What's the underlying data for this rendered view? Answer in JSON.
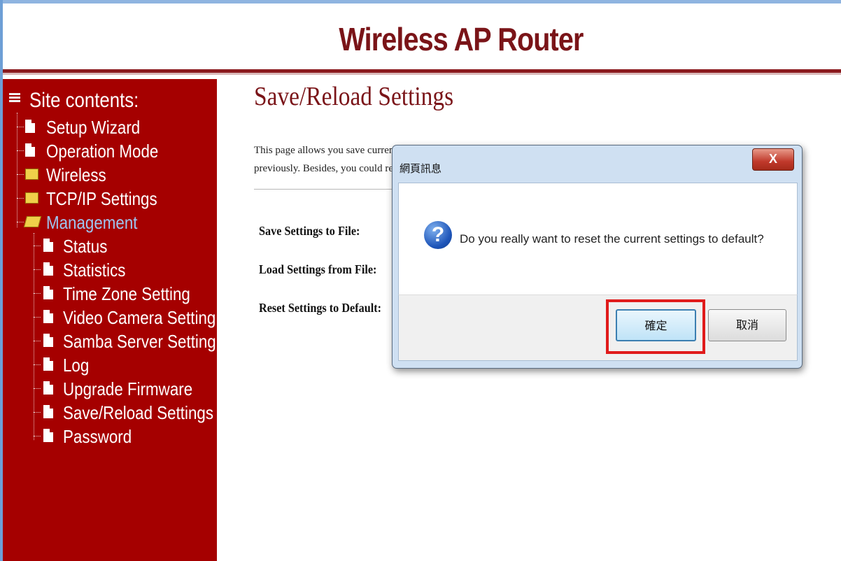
{
  "header": {
    "title": "Wireless AP Router"
  },
  "sidebar": {
    "heading": "Site contents:",
    "items": [
      {
        "label": "Setup Wizard",
        "icon": "document-icon"
      },
      {
        "label": "Operation Mode",
        "icon": "document-icon"
      },
      {
        "label": "Wireless",
        "icon": "folder-icon"
      },
      {
        "label": "TCP/IP Settings",
        "icon": "folder-icon"
      },
      {
        "label": "Management",
        "icon": "folder-open-icon",
        "active": true
      },
      {
        "label": "Status",
        "icon": "document-icon"
      },
      {
        "label": "Statistics",
        "icon": "document-icon"
      },
      {
        "label": "Time Zone Setting",
        "icon": "document-icon"
      },
      {
        "label": "Video Camera Setting",
        "icon": "document-icon"
      },
      {
        "label": "Samba Server Setting",
        "icon": "document-icon"
      },
      {
        "label": "Log",
        "icon": "document-icon"
      },
      {
        "label": "Upgrade Firmware",
        "icon": "document-icon"
      },
      {
        "label": "Save/Reload Settings",
        "icon": "document-icon"
      },
      {
        "label": "Password",
        "icon": "document-icon"
      }
    ]
  },
  "main": {
    "title": "Save/Reload Settings",
    "description_line1": "This page allows you save current settings to a file or reload the settings from the file which was saved",
    "description_line2": "previously. Besides, you could reset the current configuration to factory default.",
    "rows": [
      {
        "label": "Save Settings to File:"
      },
      {
        "label": "Load Settings from File:"
      },
      {
        "label": "Reset Settings to Default:"
      }
    ]
  },
  "dialog": {
    "title": "網頁訊息",
    "close_label": "X",
    "icon": "question-icon",
    "message": "Do you really want to reset the current settings to default?",
    "ok_label": "確定",
    "cancel_label": "取消"
  },
  "colors": {
    "brand_red": "#a50000",
    "title_red": "#7a1418",
    "highlight": "#e01b1b"
  }
}
